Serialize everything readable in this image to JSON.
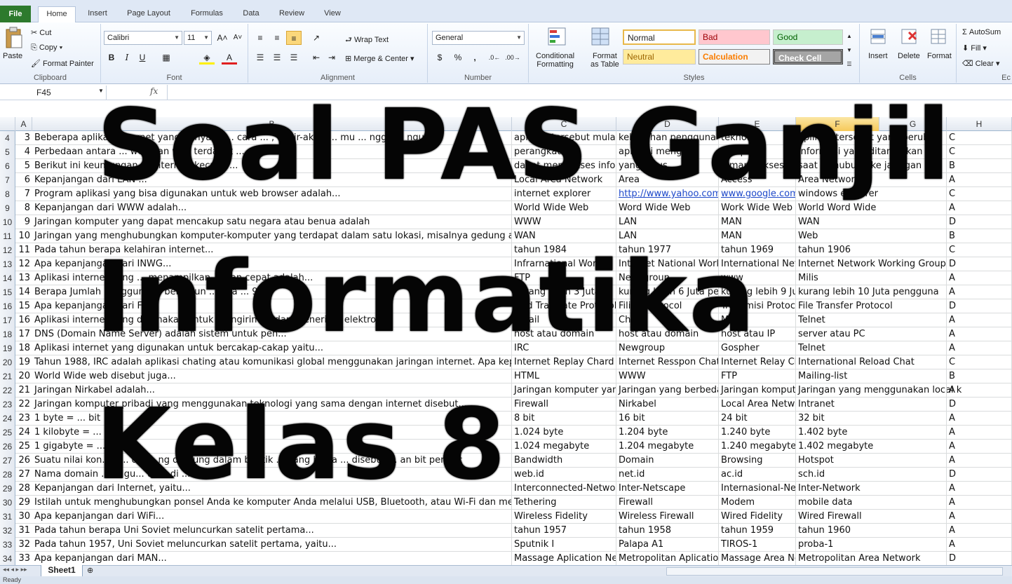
{
  "ribbon": {
    "tabs": [
      "File",
      "Home",
      "Insert",
      "Page Layout",
      "Formulas",
      "Data",
      "Review",
      "View"
    ],
    "clipboard": {
      "paste": "Paste",
      "cut": "Cut",
      "copy": "Copy",
      "format_painter": "Format Painter",
      "label": "Clipboard"
    },
    "font": {
      "name": "Calibri",
      "size": "11",
      "label": "Font"
    },
    "alignment": {
      "wrap_text": "Wrap Text",
      "merge_center": "Merge & Center",
      "label": "Alignment"
    },
    "number": {
      "format": "General",
      "label": "Number"
    },
    "styles": {
      "conditional_1": "Conditional",
      "conditional_2": "Formatting",
      "format_1": "Format",
      "format_2": "as Table",
      "normal": "Normal",
      "bad": "Bad",
      "good": "Good",
      "neutral": "Neutral",
      "calculation": "Calculation",
      "check_cell": "Check Cell",
      "label": "Styles"
    },
    "cells": {
      "insert": "Insert",
      "delete": "Delete",
      "format": "Format",
      "label": "Cells"
    },
    "editing": {
      "autosum": "AutoSum",
      "fill": "Fill",
      "clear": "Clear",
      "label_partial": "Ec"
    }
  },
  "formula_bar": {
    "name_box": "F45",
    "fx": "fx"
  },
  "columns": [
    "A",
    "B",
    "C",
    "D",
    "E",
    "F",
    "G",
    "H"
  ],
  "rows": [
    {
      "r": "4",
      "a": "3",
      "b": "Beberapa aplikasi internet yang ... nya di ... cara ... , akhir-akhir ... mu ... ngga ... ngu",
      "c": "aplikasi tersebut mulai",
      "d": "kebutuhan pengguna",
      "e": "teknologi",
      "f": "aplikasi tersebut yang berubah",
      "h": "C"
    },
    {
      "r": "5",
      "a": "4",
      "b": "Perbedaan antara ... web dan web terdapat ...",
      "c": "perangkat",
      "d": "aplikasi mengaks",
      "e": "komputer",
      "f": "informasi yang ditampilkan",
      "h": "C"
    },
    {
      "r": "6",
      "a": "5",
      "b": "Berikut ini  keuntungan ... Internet, kecuali ...",
      "c": "dapat mengakses informasi",
      "d": "yang terus",
      "e": "dimana akses",
      "f": "saat terhubung ke jaringan",
      "h": "B"
    },
    {
      "r": "7",
      "a": "6",
      "b": "Kepanjangan dari LAN ...",
      "c": "Local Area Network",
      "d": "Area",
      "e": "Access",
      "f": "Area Network",
      "h": "A"
    },
    {
      "r": "8",
      "a": "7",
      "b": "Program aplikasi yang bisa digunakan untuk web browser adalah...",
      "c": "internet explorer",
      "d": "http://www.yahoo.com",
      "e": "www.google.com",
      "f": "windows explorer",
      "h": "C"
    },
    {
      "r": "9",
      "a": "8",
      "b": "Kepanjangan dari WWW adalah...",
      "c": "World  Wide Web",
      "d": "Word Wide Web",
      "e": "Work Wide Web",
      "f": "World Word Wide",
      "h": "A"
    },
    {
      "r": "10",
      "a": "9",
      "b": "Jaringan komputer yang dapat mencakup satu negara atau benua adalah",
      "c": "WWW",
      "d": "LAN",
      "e": "MAN",
      "f": "WAN",
      "h": "D"
    },
    {
      "r": "11",
      "a": "10",
      "b": "Jaringan yang menghubungkan komputer-komputer yang terdapat dalam satu lokasi, misalnya gedung atau perkantoran",
      "c": "WAN",
      "d": "LAN",
      "e": "MAN",
      "f": "Web",
      "h": "B"
    },
    {
      "r": "12",
      "a": "11",
      "b": "Pada tahun berapa kelahiran internet...",
      "c": "tahun 1984",
      "d": "tahun 1977",
      "e": "tahun 1969",
      "f": "tahun 1906",
      "h": "C"
    },
    {
      "r": "13",
      "a": "12",
      "b": "Apa kepanjangan dari INWG...",
      "c": "Infrarnational Work",
      "d": "Internet National Work",
      "e": "International Net",
      "f": "Internet Network Working Group",
      "h": "D"
    },
    {
      "r": "14",
      "a": "13",
      "b": "Aplikasi internet yang ... menampilkan ... gan cepat adalah...",
      "c": "FTP",
      "d": "Newsgroup",
      "e": "www",
      "f": "Milis",
      "h": "A"
    },
    {
      "r": "15",
      "a": "14",
      "b": "Berapa Jumlah pengguna ... bertahun ... ada ... 94",
      "c": "kurang lebih 3 Juta",
      "d": "kurang lebih 6 Juta pengguna",
      "e": "kurang lebih 9 Juta",
      "f": "kurang lebih 10 Juta pengguna",
      "h": "A"
    },
    {
      "r": "16",
      "a": "15",
      "b": "Apa kepanjangan dari F...",
      "c": "Find Translate Protocol",
      "d": "Filing Protocol",
      "e": "Transmisi Protocol",
      "f": "File Transfer Protocol",
      "h": "D"
    },
    {
      "r": "17",
      "a": "16",
      "b": "Aplikasi internet yang digunakan untuk mengirim ... dan menerima elektronik",
      "c": "Email",
      "d": "Chat",
      "e": "Milis",
      "f": "Telnet",
      "h": "A"
    },
    {
      "r": "18",
      "a": "17",
      "b": "DNS (Domain Name Server) adalah sistem untuk pen...",
      "c": "host atau domain",
      "d": "host atau domain",
      "e": "host atau IP",
      "f": "server atau PC",
      "h": "A"
    },
    {
      "r": "19",
      "a": "18",
      "b": "Aplikasi internet yang digunakan untuk bercakap-cakap yaitu...",
      "c": "IRC",
      "d": "Newgroup",
      "e": "Gospher",
      "f": "Telnet",
      "h": "A"
    },
    {
      "r": "20",
      "a": "19",
      "b": "Tahun 1988, IRC adalah aplikasi chating atau komunikasi global menggunakan jaringan internet. Apa kepanjangan dari IRC",
      "c": "Internet Replay Chard",
      "d": "Internet Resspon Chatting",
      "e": "Internet Relay Chat",
      "f": "International Reload Chat",
      "h": "C"
    },
    {
      "r": "21",
      "a": "20",
      "b": "World  Wide web disebut juga...",
      "c": "HTML",
      "d": "WWW",
      "e": "FTP",
      "f": "Mailing-list",
      "h": "B"
    },
    {
      "r": "22",
      "a": "21",
      "b": "Jaringan Nirkabel adalah...",
      "c": "Jaringan komputer yang",
      "d": "Jaringan yang berbeda-",
      "e": "Jaringan komputer",
      "f": "Jaringan yang menggunakan local k",
      "h": "A"
    },
    {
      "r": "23",
      "a": "22",
      "b": "Jaringan komputer pribadi yang menggunakan teknologi yang sama dengan internet disebut...",
      "c": "Firewall",
      "d": "Nirkabel",
      "e": "Local Area Network",
      "f": "Intranet",
      "h": "D"
    },
    {
      "r": "24",
      "a": "23",
      "b": "1 byte = ... bit",
      "c": "8 bit",
      "d": "16 bit",
      "e": "24 bit",
      "f": "32 bit",
      "h": "A"
    },
    {
      "r": "25",
      "a": "24",
      "b": "1 kilobyte = ...",
      "c": "1.024 byte",
      "d": "1.204 byte",
      "e": "1.240 byte",
      "f": "1.402 byte",
      "h": "A"
    },
    {
      "r": "26",
      "a": "25",
      "b": "1 gigabyte = ...",
      "c": "1.024 megabyte",
      "d": "1.204 megabyte",
      "e": "1.240 megabyte",
      "f": "1.402 megabyte",
      "h": "A"
    },
    {
      "r": "27",
      "a": "26",
      "b": "Suatu nilai kon... tr... dat... ng dihitung dalam b... tik ... yang biasa ... disebut ... an bit per sec",
      "c": "Bandwidth",
      "d": "Domain",
      "e": "Browsing",
      "f": "Hotspot",
      "h": "A"
    },
    {
      "r": "28",
      "a": "27",
      "b": "Nama domain ... di gu... un... di ... s",
      "c": "web.id",
      "d": "net.id",
      "e": "ac.id",
      "f": "sch.id",
      "h": "D"
    },
    {
      "r": "29",
      "a": "28",
      "b": "Kepanjangan dari Internet, yaitu...",
      "c": "Interconnected-Network",
      "d": "Inter-Netscape",
      "e": "Internasional-Network",
      "f": "Inter-Network",
      "h": "A"
    },
    {
      "r": "30",
      "a": "29",
      "b": "Istilah untuk menghubungkan ponsel Anda ke komputer Anda melalui USB, Bluetooth, atau Wi-Fi dan menggunakan",
      "c": "Tethering",
      "d": "Firewall",
      "e": "Modem",
      "f": "mobile data",
      "h": "A"
    },
    {
      "r": "31",
      "a": "30",
      "b": "Apa kepanjangan dari WiFi...",
      "c": "Wireless Fidelity",
      "d": "Wireless Firewall",
      "e": "Wired Fidelity",
      "f": "Wired Firewall",
      "h": "A"
    },
    {
      "r": "32",
      "a": "31",
      "b": "Pada tahun berapa Uni Soviet meluncurkan satelit pertama...",
      "c": "tahun 1957",
      "d": "tahun 1958",
      "e": "tahun 1959",
      "f": "tahun 1960",
      "h": "A"
    },
    {
      "r": "33",
      "a": "32",
      "b": "Pada tahun 1957, Uni Soviet meluncurkan satelit pertama, yaitu...",
      "c": "Sputnik I",
      "d": "Palapa A1",
      "e": "TIROS-1",
      "f": "proba-1",
      "h": "A"
    },
    {
      "r": "34",
      "a": "33",
      "b": "Apa kepanjangan dari MAN...",
      "c": "Massage Aplication Network",
      "d": "Metropolitan Aplication",
      "e": "Massage Area Network",
      "f": "Metropolitan Area Network",
      "h": "D"
    }
  ],
  "sheet": {
    "tab": "Sheet1",
    "status": "Ready"
  },
  "overlay": {
    "line1": "Soal PAS Ganjil",
    "line2": "Informatika",
    "line3": "Kelas 8"
  },
  "colors": {
    "file_tab": "#2d7a2d",
    "selected_col": "#f6c95a",
    "overlay_text": "#050505"
  }
}
